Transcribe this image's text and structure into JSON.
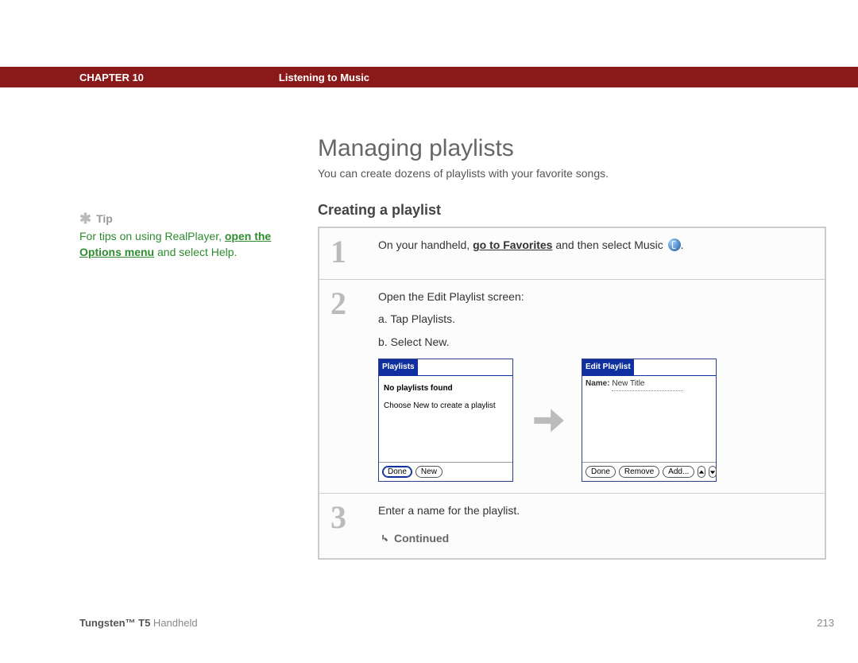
{
  "header": {
    "chapter": "CHAPTER 10",
    "topic": "Listening to Music"
  },
  "sidebar": {
    "tip_label": "Tip",
    "tip_pre": "For tips on using RealPlayer, ",
    "tip_link": "open the Options menu",
    "tip_post": " and select Help."
  },
  "main": {
    "title": "Managing playlists",
    "intro": "You can create dozens of playlists with your favorite songs.",
    "subsection": "Creating a playlist"
  },
  "steps": {
    "s1_num": "1",
    "s1_pre": "On your handheld, ",
    "s1_link": "go to Favorites",
    "s1_post": " and then select Music ",
    "s1_end": ".",
    "s2_num": "2",
    "s2_line": "Open the Edit Playlist screen:",
    "s2_a": "a.  Tap Playlists.",
    "s2_b": "b.  Select New.",
    "s3_num": "3",
    "s3_line": "Enter a name for the playlist.",
    "continued": "Continued"
  },
  "screens": {
    "left": {
      "title": "Playlists",
      "msg1": "No playlists found",
      "msg2": "Choose New to create a playlist",
      "btn_done": "Done",
      "btn_new": "New"
    },
    "right": {
      "title": "Edit Playlist",
      "name_label": "Name:",
      "name_value": "New Title",
      "btn_done": "Done",
      "btn_remove": "Remove",
      "btn_add": "Add..."
    }
  },
  "footer": {
    "product_bold": "Tungsten™ T5",
    "product_rest": " Handheld",
    "page": "213"
  }
}
